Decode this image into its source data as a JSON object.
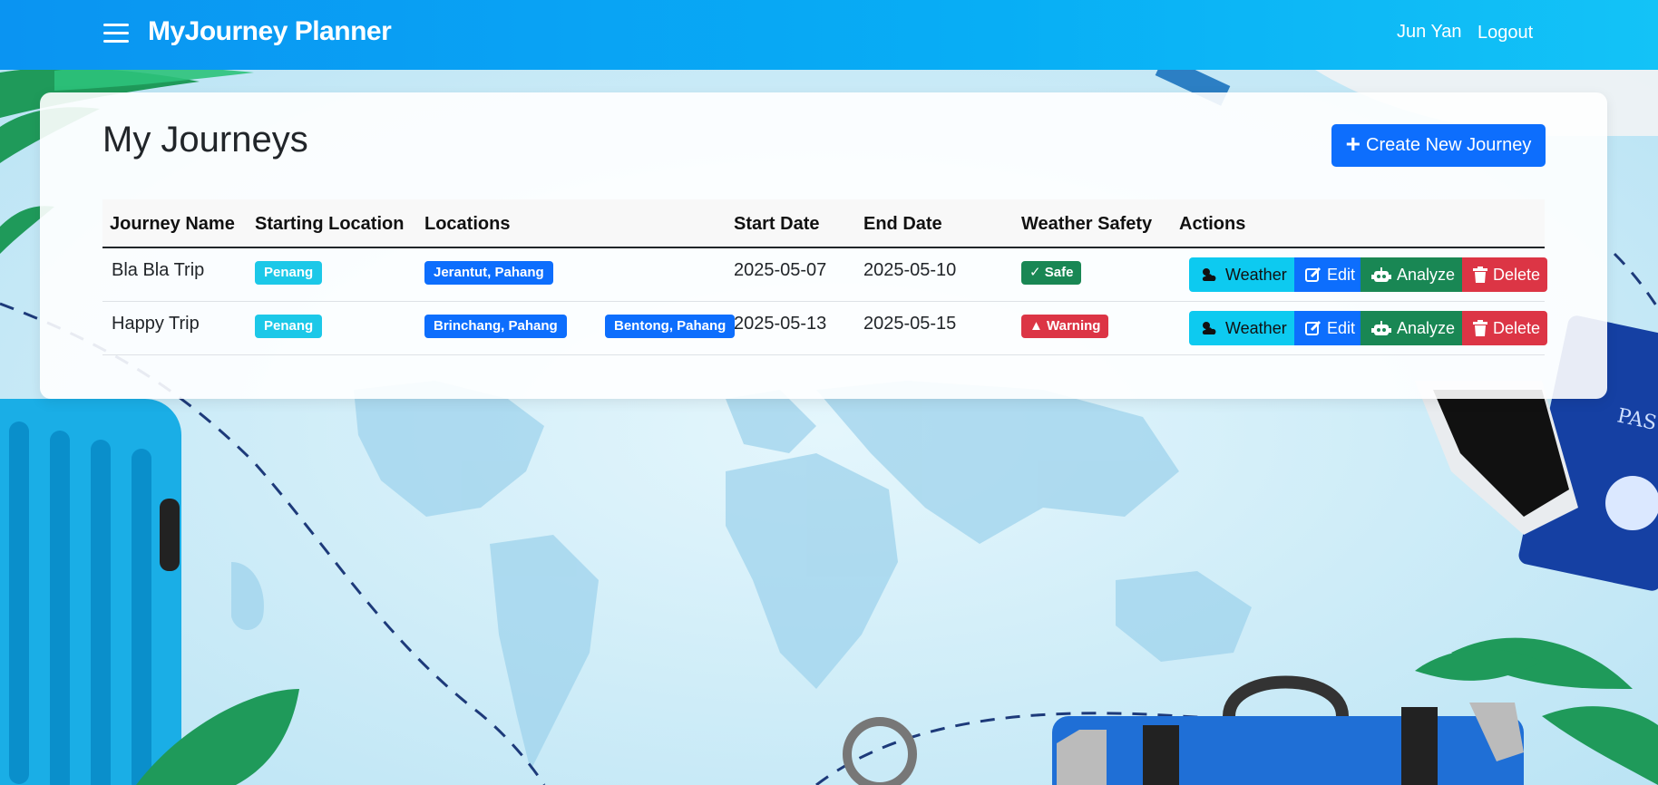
{
  "navbar": {
    "brand": "MyJourney Planner",
    "user_name": "Jun Yan",
    "logout_label": "Logout",
    "menu_icon": "hamburger-icon",
    "color": "#0a94f2"
  },
  "main": {
    "title": "My Journeys",
    "create_button_label": "Create New Journey",
    "create_button_icon": "plus-icon"
  },
  "table": {
    "headers": [
      "Journey Name",
      "Starting Location",
      "Locations",
      "Start Date",
      "End Date",
      "Weather Safety",
      "Actions"
    ],
    "rows": [
      {
        "name": "Bla Bla Trip",
        "start_location": "Penang",
        "locations": [
          "Jerantut, Pahang"
        ],
        "start_date": "2025-05-07",
        "end_date": "2025-05-10",
        "safety": "Safe",
        "safety_icon": "check-icon"
      },
      {
        "name": "Happy Trip",
        "start_location": "Penang",
        "locations": [
          "Brinchang, Pahang",
          "Bentong, Pahang"
        ],
        "start_date": "2025-05-13",
        "end_date": "2025-05-15",
        "safety": "Warning",
        "safety_icon": "warning-triangle-icon"
      }
    ],
    "actions": {
      "weather": "Weather",
      "edit": "Edit",
      "analyze": "Analyze",
      "delete": "Delete"
    }
  },
  "colors": {
    "primary": "#0d6efd",
    "info": "#0dcaf0",
    "success": "#198754",
    "danger": "#dc3545",
    "badge_cyan": "#1cc8e8"
  }
}
